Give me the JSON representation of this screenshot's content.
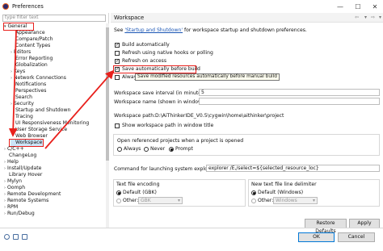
{
  "window": {
    "title": "Preferences",
    "minimize": "—",
    "maximize": "☐",
    "close": "✕",
    "icon": "eclipse-icon"
  },
  "filter": {
    "placeholder": "type filter text"
  },
  "tree": {
    "general": "General",
    "children": [
      "Appearance",
      "Compare/Patch",
      "Content Types",
      "Editors",
      "Error Reporting",
      "Globalization",
      "Keys",
      "Network Connections",
      "Notifications",
      "Perspectives",
      "Search",
      "Security",
      "Startup and Shutdown",
      "Tracing",
      "UI Responsiveness Monitoring",
      "User Storage Service",
      "Web Browser",
      "Workspace"
    ],
    "top_level": [
      "C/C++",
      "ChangeLog",
      "Help",
      "Install/Update",
      "Library Hover",
      "Mylyn",
      "Oomph",
      "Remote Development",
      "Remote Systems",
      "RPM",
      "Run/Debug"
    ]
  },
  "panel": {
    "title": "Workspace",
    "see_prefix": "See ",
    "see_link": "'Startup and Shutdown'",
    "see_suffix": " for workspace startup and shutdown preferences.",
    "checks": [
      {
        "label": "Build automatically",
        "checked": true
      },
      {
        "label": "Refresh using native hooks or polling",
        "checked": false
      },
      {
        "label": "Refresh on access",
        "checked": true
      },
      {
        "label": "Save automatically before build",
        "checked": true
      },
      {
        "label": "Alway",
        "checked": false
      }
    ],
    "tooltip": "Save modified resources automatically before manual build",
    "save_interval_label": "Workspace save interval (in minutes):",
    "save_interval_value": "5",
    "ws_name_label": "Workspace name (shown in window title):",
    "ws_name_value": "",
    "ws_path_label": "Workspace path:",
    "ws_path_value": "D:\\AiThinkerIDE_V0.5\\cygwin\\home\\aithinker\\project",
    "show_path_label": "Show workspace path in window title",
    "open_ref_label": "Open referenced projects when a project is opened",
    "open_ref_options": [
      "Always",
      "Never",
      "Prompt"
    ],
    "open_ref_selected": "Prompt",
    "explorer_label": "Command for launching system explorer:",
    "explorer_value": "explorer /E,/select=${selected_resource_loc}",
    "encoding_label": "Text file encoding",
    "encoding_default": "Default (GBK)",
    "encoding_other": "Other:",
    "encoding_other_value": "GBK",
    "delim_label": "New text file line delimiter",
    "delim_default": "Default (Windows)",
    "delim_other": "Other:",
    "delim_other_value": "Windows",
    "restore_defaults": "Restore Defaults",
    "apply": "Apply"
  },
  "footer": {
    "ok": "OK",
    "cancel": "Cancel"
  },
  "colors": {
    "annotation": "#e8201c",
    "link": "#1a55b4",
    "selection": "#cce4f7"
  }
}
